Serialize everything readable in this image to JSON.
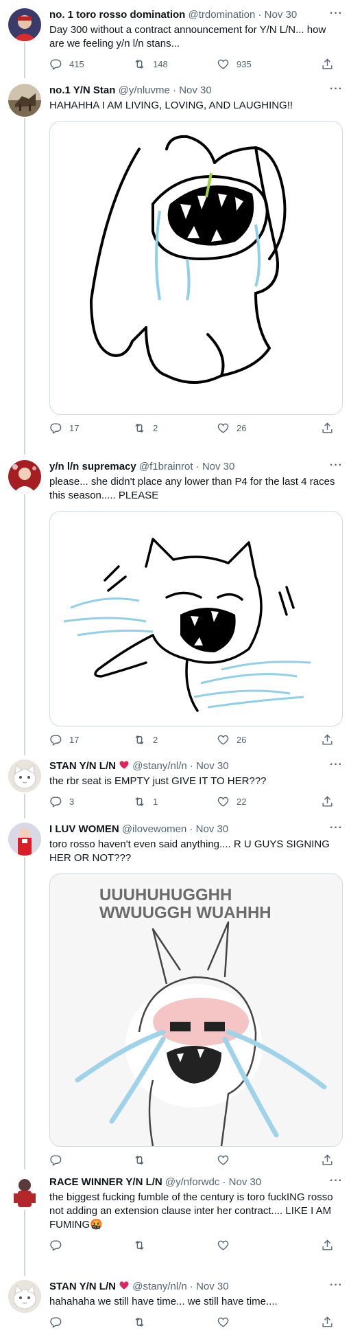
{
  "tweets": [
    {
      "name": "no. 1 toro rosso domination",
      "handle": "@trdomination",
      "time": "Nov 30",
      "text": "Day 300 without a contract announcement for Y/N L/N... how are we feeling y/n l/n stans...",
      "replies": "415",
      "retweets": "148",
      "likes": "935"
    },
    {
      "name": "no.1 Y/N Stan",
      "handle": "@y/nluvme",
      "time": "Nov 30",
      "text": "HAHAHHA I AM LIVING, LOVING, AND LAUGHING!!",
      "replies": "17",
      "retweets": "2",
      "likes": "26"
    },
    {
      "name": "y/n l/n supremacy",
      "handle": "@f1brainrot",
      "time": "Nov 30",
      "text": "please... she didn't place any lower than P4 for the last 4 races this season..... PLEASE",
      "replies": "17",
      "retweets": "2",
      "likes": "26"
    },
    {
      "name": "STAN Y/N L/N",
      "handle": "@stany/nl/n",
      "time": "Nov 30",
      "text": "the rbr seat is EMPTY just GIVE IT TO HER???",
      "replies": "3",
      "retweets": "1",
      "likes": "22"
    },
    {
      "name": "I LUV WOMEN",
      "handle": "@ilovewomen",
      "time": "Nov 30",
      "text": "toro rosso haven't even said anything.... R U GUYS SIGNING HER OR NOT???",
      "image_caption": "UUUHUHUGGHH WWUUGGH WUAHHH",
      "replies": "",
      "retweets": "",
      "likes": ""
    },
    {
      "name": "RACE WINNER Y/N L/N",
      "handle": "@y/nforwdc",
      "time": "Nov 30",
      "text": "the biggest fucking fumble of the century is toro fuckING rosso not adding an extension clause inter her contract.... LIKE I AM FUMING",
      "emoji": "🤬",
      "replies": "",
      "retweets": "",
      "likes": ""
    },
    {
      "name": "STAN Y/N L/N",
      "handle": "@stany/nl/n",
      "time": "Nov 30",
      "text": "hahahaha we still have time... we still have time....",
      "replies": "",
      "retweets": "",
      "likes": ""
    }
  ],
  "separator": "·",
  "more_label": "···",
  "colors": {
    "text": "#0f1419",
    "meta": "#536471",
    "thread": "#cfd9de",
    "heart_emoji": "#e0245e"
  },
  "icons": [
    "reply-icon",
    "retweet-icon",
    "like-icon",
    "share-icon",
    "more-icon"
  ]
}
